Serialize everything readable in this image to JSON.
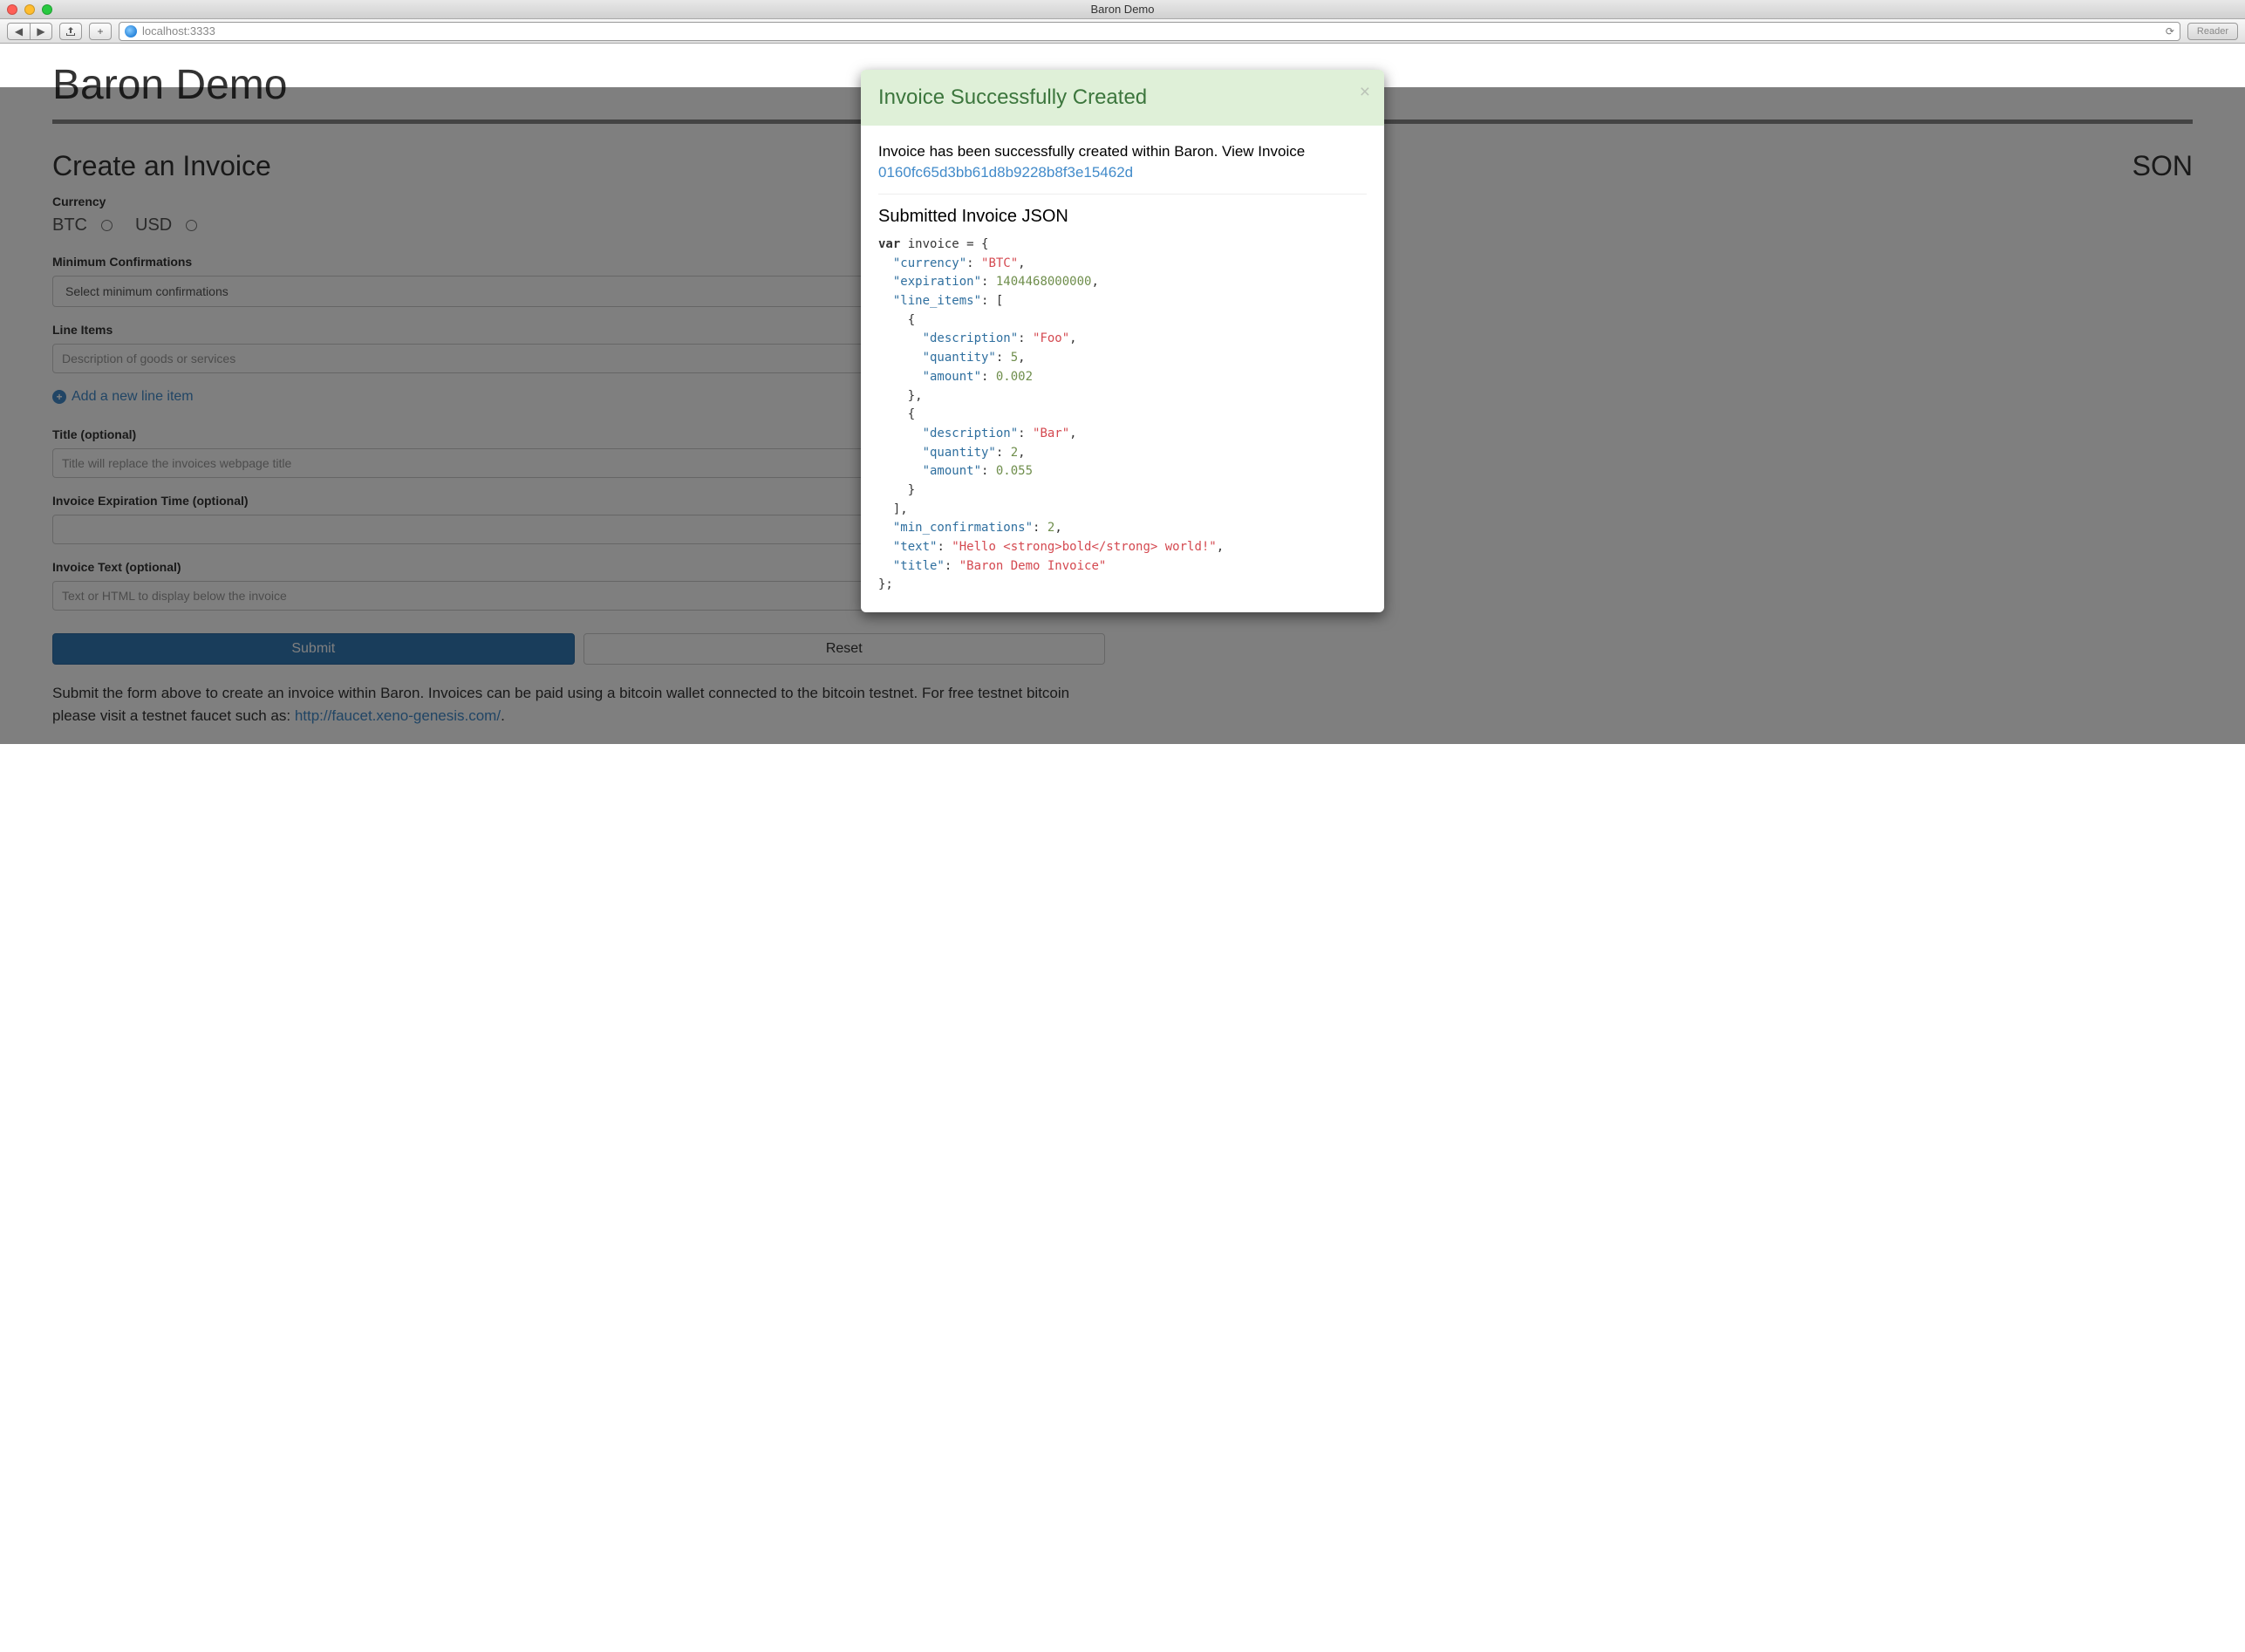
{
  "window": {
    "title": "Baron Demo"
  },
  "toolbar": {
    "url": "localhost:3333",
    "reader": "Reader"
  },
  "page": {
    "title": "Baron Demo",
    "left": {
      "heading": "Create an Invoice",
      "currency_label": "Currency",
      "currency_btc": "BTC",
      "currency_usd": "USD",
      "min_conf_label": "Minimum Confirmations",
      "min_conf_placeholder": "Select minimum confirmations",
      "line_items_label": "Line Items",
      "desc_placeholder": "Description of goods or services",
      "add_line": "Add a new line item",
      "title_label": "Title (optional)",
      "title_placeholder": "Title will replace the invoices webpage title",
      "exp_label": "Invoice Expiration Time (optional)",
      "text_label": "Invoice Text (optional)",
      "text_placeholder": "Text or HTML to display below the invoice",
      "submit": "Submit",
      "reset": "Reset",
      "help": "Submit the form above to create an invoice within Baron. Invoices can be paid using a bitcoin wallet connected to the bitcoin testnet. For free testnet bitcoin please visit a testnet faucet such as: ",
      "help_link": "http://faucet.xeno-genesis.com/"
    },
    "right": {
      "heading_fragment": "SON"
    }
  },
  "modal": {
    "title": "Invoice Successfully Created",
    "message": "Invoice has been successfully created within Baron. View Invoice",
    "link": "0160fc65d3bb61d8b9228b8f3e15462d",
    "subtitle": "Submitted Invoice JSON",
    "json": {
      "var": "var",
      "name": "invoice",
      "currency_key": "\"currency\"",
      "currency_val": "\"BTC\"",
      "expiration_key": "\"expiration\"",
      "expiration_val": "1404468000000",
      "line_items_key": "\"line_items\"",
      "desc_key": "\"description\"",
      "foo_val": "\"Foo\"",
      "qty_key": "\"quantity\"",
      "qty1": "5",
      "amt_key": "\"amount\"",
      "amt1": "0.002",
      "bar_val": "\"Bar\"",
      "qty2": "2",
      "amt2": "0.055",
      "min_conf_key": "\"min_confirmations\"",
      "min_conf_val": "2",
      "text_key": "\"text\"",
      "text_val": "\"Hello <strong>bold</strong> world!\"",
      "title_key": "\"title\"",
      "title_val": "\"Baron Demo Invoice\""
    }
  }
}
